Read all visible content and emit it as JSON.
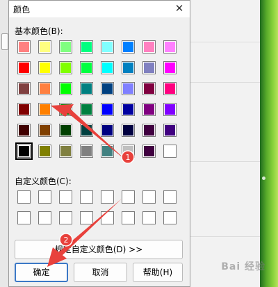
{
  "dialog": {
    "title": "颜色",
    "basic_colors_label": "基本颜色(B):",
    "custom_colors_label": "自定义颜色(C):",
    "define_custom_button": "规定自定义颜色(D) >>",
    "ok_button": "确定",
    "cancel_button": "取消",
    "help_button": "帮助(H)",
    "close_symbol": "✕"
  },
  "basic_colors": [
    [
      "#ff8080",
      "#ffff80",
      "#80ff80",
      "#00ff80",
      "#80ffff",
      "#0080ff",
      "#ff80c0",
      "#ff80ff"
    ],
    [
      "#ff0000",
      "#ffff00",
      "#80ff00",
      "#00ff40",
      "#00ffff",
      "#0080c0",
      "#8080c0",
      "#ff00ff"
    ],
    [
      "#804040",
      "#ff8040",
      "#00ff00",
      "#008080",
      "#004080",
      "#8080ff",
      "#800040",
      "#ff0080"
    ],
    [
      "#800000",
      "#ff8000",
      "#008000",
      "#008040",
      "#0000ff",
      "#0000a0",
      "#800080",
      "#8000ff"
    ],
    [
      "#400000",
      "#804000",
      "#004000",
      "#004040",
      "#000080",
      "#000040",
      "#400040",
      "#400080"
    ],
    [
      "#000000",
      "#808000",
      "#808040",
      "#808080",
      "#408080",
      "#c0c0c0",
      "#400040",
      "#ffffff"
    ]
  ],
  "selected_swatch": {
    "row": 5,
    "col": 0
  },
  "annotations": {
    "marker1": "1",
    "marker2": "2",
    "marker_color": "#e8413c"
  },
  "watermark": "Bai 经验"
}
